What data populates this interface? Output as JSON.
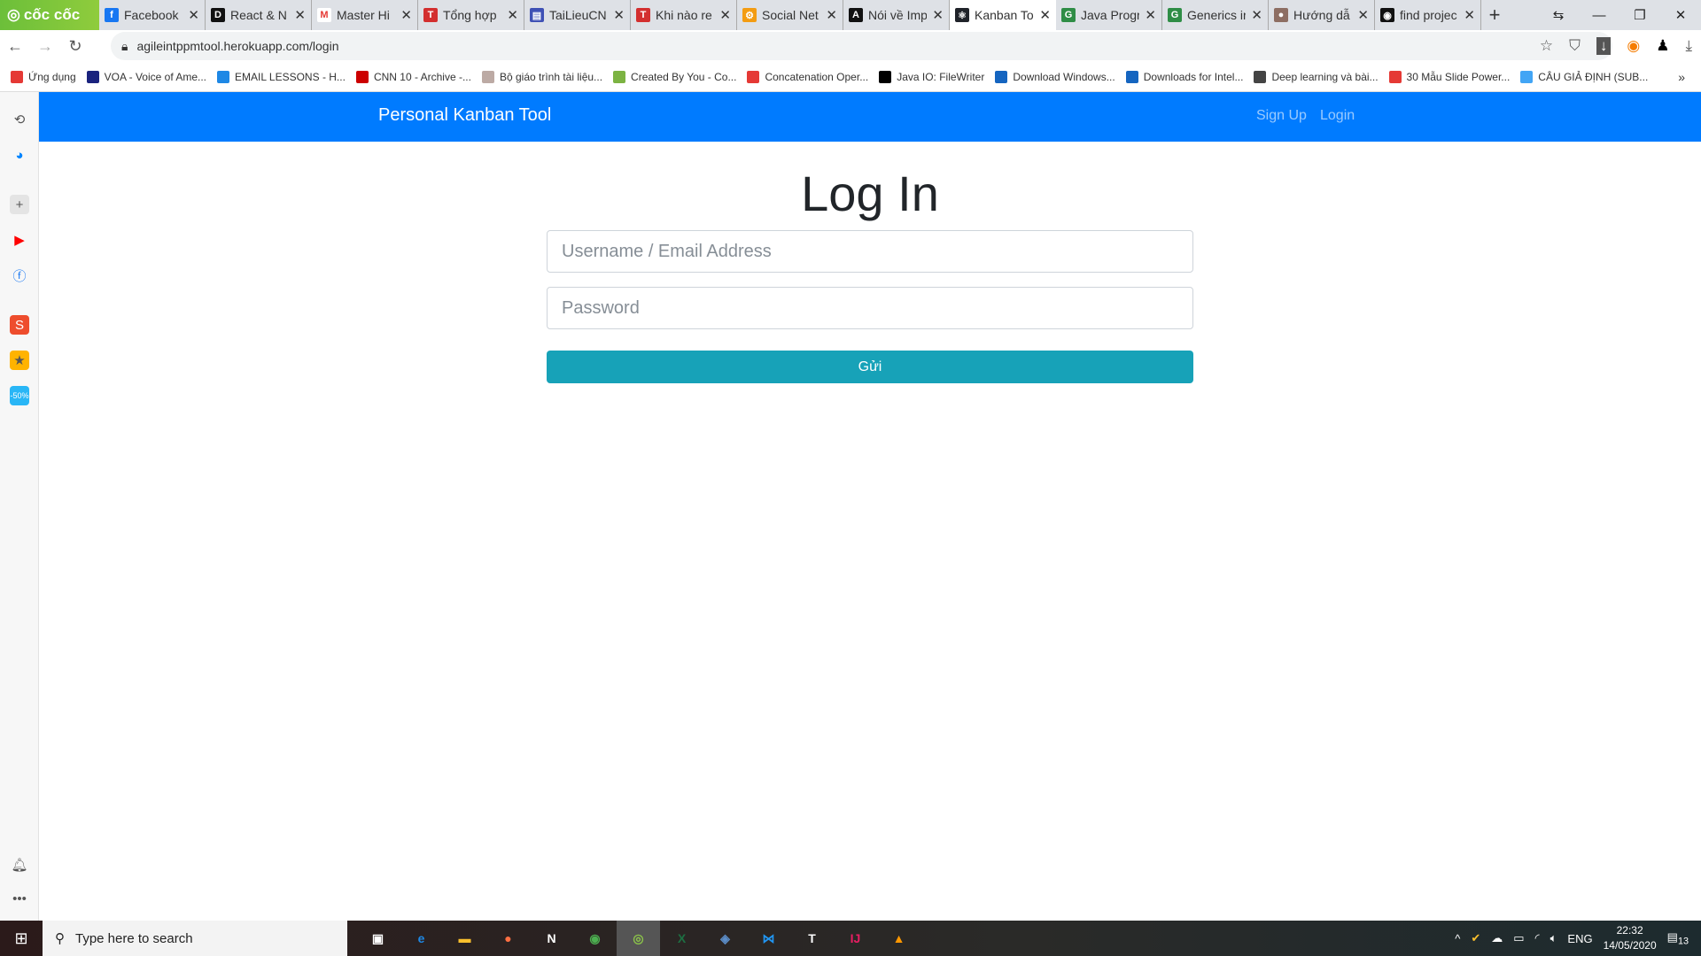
{
  "browser": {
    "logo": "cốc cốc",
    "tabs": [
      {
        "title": "Facebook",
        "color": "#1877f2",
        "glyph": "f"
      },
      {
        "title": "React & N",
        "color": "#111",
        "glyph": "D"
      },
      {
        "title": "Master Hi",
        "color": "#fff",
        "glyph": "M"
      },
      {
        "title": "Tổng hợp",
        "color": "#d32f2f",
        "glyph": "T"
      },
      {
        "title": "TaiLieuCN",
        "color": "#3f51b5",
        "glyph": "▤"
      },
      {
        "title": "Khi nào re",
        "color": "#d32f2f",
        "glyph": "T"
      },
      {
        "title": "Social Net",
        "color": "#f39c12",
        "glyph": "⚙"
      },
      {
        "title": "Nói về Imp",
        "color": "#111",
        "glyph": "A"
      },
      {
        "title": "Kanban To",
        "color": "#20232a",
        "glyph": "⚛",
        "active": true
      },
      {
        "title": "Java Progr",
        "color": "#2f8d46",
        "glyph": "G"
      },
      {
        "title": "Generics ir",
        "color": "#2f8d46",
        "glyph": "G"
      },
      {
        "title": "Hướng dẫ",
        "color": "#8d6e63",
        "glyph": "●"
      },
      {
        "title": "find projec",
        "color": "#111",
        "glyph": "◉"
      }
    ],
    "url": "agileintppmtool.herokuapp.com/login",
    "bookmarks": [
      {
        "label": "Ứng dụng",
        "color": "#e53935"
      },
      {
        "label": "VOA - Voice of Ame...",
        "color": "#1a237e"
      },
      {
        "label": "EMAIL LESSONS - H...",
        "color": "#1e88e5"
      },
      {
        "label": "CNN 10 - Archive -...",
        "color": "#cc0000"
      },
      {
        "label": "Bộ giáo trình tài liệu...",
        "color": "#bcaaa4"
      },
      {
        "label": "Created By You - Co...",
        "color": "#7cb342"
      },
      {
        "label": "Concatenation Oper...",
        "color": "#e53935"
      },
      {
        "label": "Java IO: FileWriter",
        "color": "#000"
      },
      {
        "label": "Download Windows...",
        "color": "#1565c0"
      },
      {
        "label": "Downloads for Intel...",
        "color": "#1565c0"
      },
      {
        "label": "Deep learning và bài...",
        "color": "#444"
      },
      {
        "label": "30 Mẫu Slide Power...",
        "color": "#e53935"
      },
      {
        "label": "CÂU GIẢ ĐỊNH (SUB...",
        "color": "#42a5f5"
      }
    ]
  },
  "app": {
    "brand": "Personal Kanban Tool",
    "nav": [
      "Sign Up",
      "Login"
    ],
    "title": "Log In",
    "username_placeholder": "Username / Email Address",
    "password_placeholder": "Password",
    "submit": "Gửi",
    "accent": "#007bff",
    "button_color": "#17a2b8"
  },
  "taskbar": {
    "search_placeholder": "Type here to search",
    "lang": "ENG",
    "time": "22:32",
    "date": "14/05/2020",
    "notifications": "13"
  }
}
